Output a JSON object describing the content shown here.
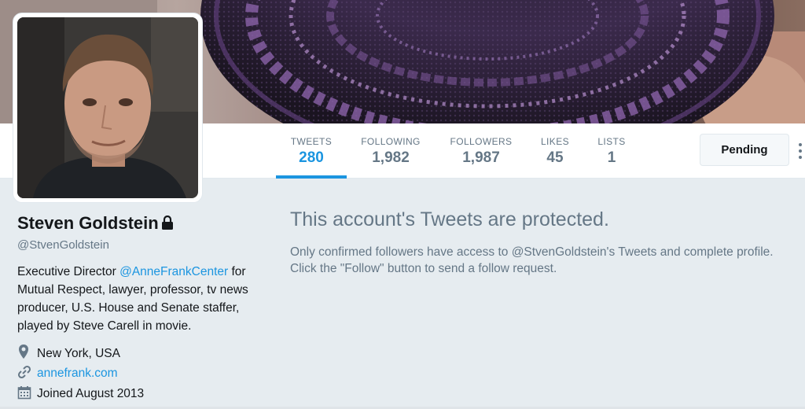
{
  "profile": {
    "name": "Steven Goldstein",
    "screen_name": "@StvenGoldstein",
    "protected": true,
    "bio": {
      "prefix": "Executive Director ",
      "mention": "@AnneFrankCenter",
      "suffix": " for Mutual Respect, lawyer, professor, tv news producer, U.S. House and Senate staffer, played by Steve Carell in movie."
    },
    "location": "New York, USA",
    "url": "annefrank.com",
    "joined": "Joined August 2013"
  },
  "nav": {
    "stats": [
      {
        "label": "TWEETS",
        "value": "280",
        "active": true
      },
      {
        "label": "FOLLOWING",
        "value": "1,982",
        "active": false
      },
      {
        "label": "FOLLOWERS",
        "value": "1,987",
        "active": false
      },
      {
        "label": "LIKES",
        "value": "45",
        "active": false
      },
      {
        "label": "LISTS",
        "value": "1",
        "active": false
      }
    ],
    "pending_label": "Pending"
  },
  "protected_notice": {
    "title": "This account's Tweets are protected.",
    "text": "Only confirmed followers have access to @StvenGoldstein's Tweets and complete profile. Click the \"Follow\" button to send a follow request."
  },
  "colors": {
    "accent": "#1b95e0",
    "muted": "#657786",
    "background": "#e6ecf0"
  },
  "icons": {
    "location": "map-pin-icon",
    "url": "link-icon",
    "joined": "calendar-icon",
    "protected": "lock-icon",
    "more": "more-vertical-icon"
  }
}
